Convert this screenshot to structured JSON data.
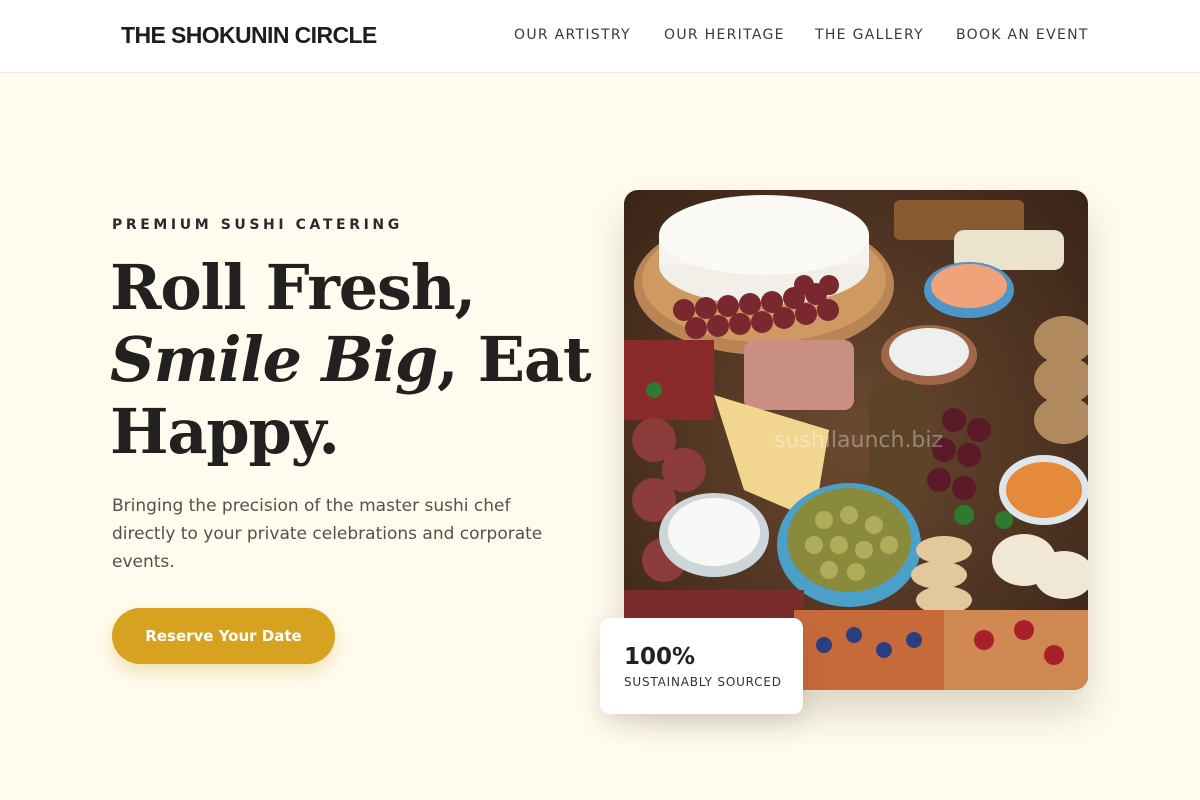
{
  "header": {
    "brand": "THE SHOKUNIN CIRCLE",
    "nav": [
      {
        "label": "OUR ARTISTRY"
      },
      {
        "label": "OUR HERITAGE"
      },
      {
        "label": "THE GALLERY"
      },
      {
        "label": "BOOK AN EVENT"
      }
    ]
  },
  "hero": {
    "eyebrow": "PREMIUM SUSHI CATERING",
    "headline": {
      "line1": "Roll Fresh,",
      "italic": "Smile Big",
      "line2_rest": ", Eat",
      "line3": "Happy."
    },
    "description": "Bringing the precision of the master sushi chef directly to your private celebrations and corporate events.",
    "cta_label": "Reserve Your Date",
    "image": {
      "watermark": "sushilaunch.biz"
    },
    "stat": {
      "value": "100%",
      "label": "SUSTAINABLY SOURCED"
    }
  },
  "colors": {
    "page_background": "#fffcef",
    "header_background": "#ffffff",
    "accent": "#d6a21f",
    "heading_text": "#232120",
    "body_text": "#555049"
  }
}
